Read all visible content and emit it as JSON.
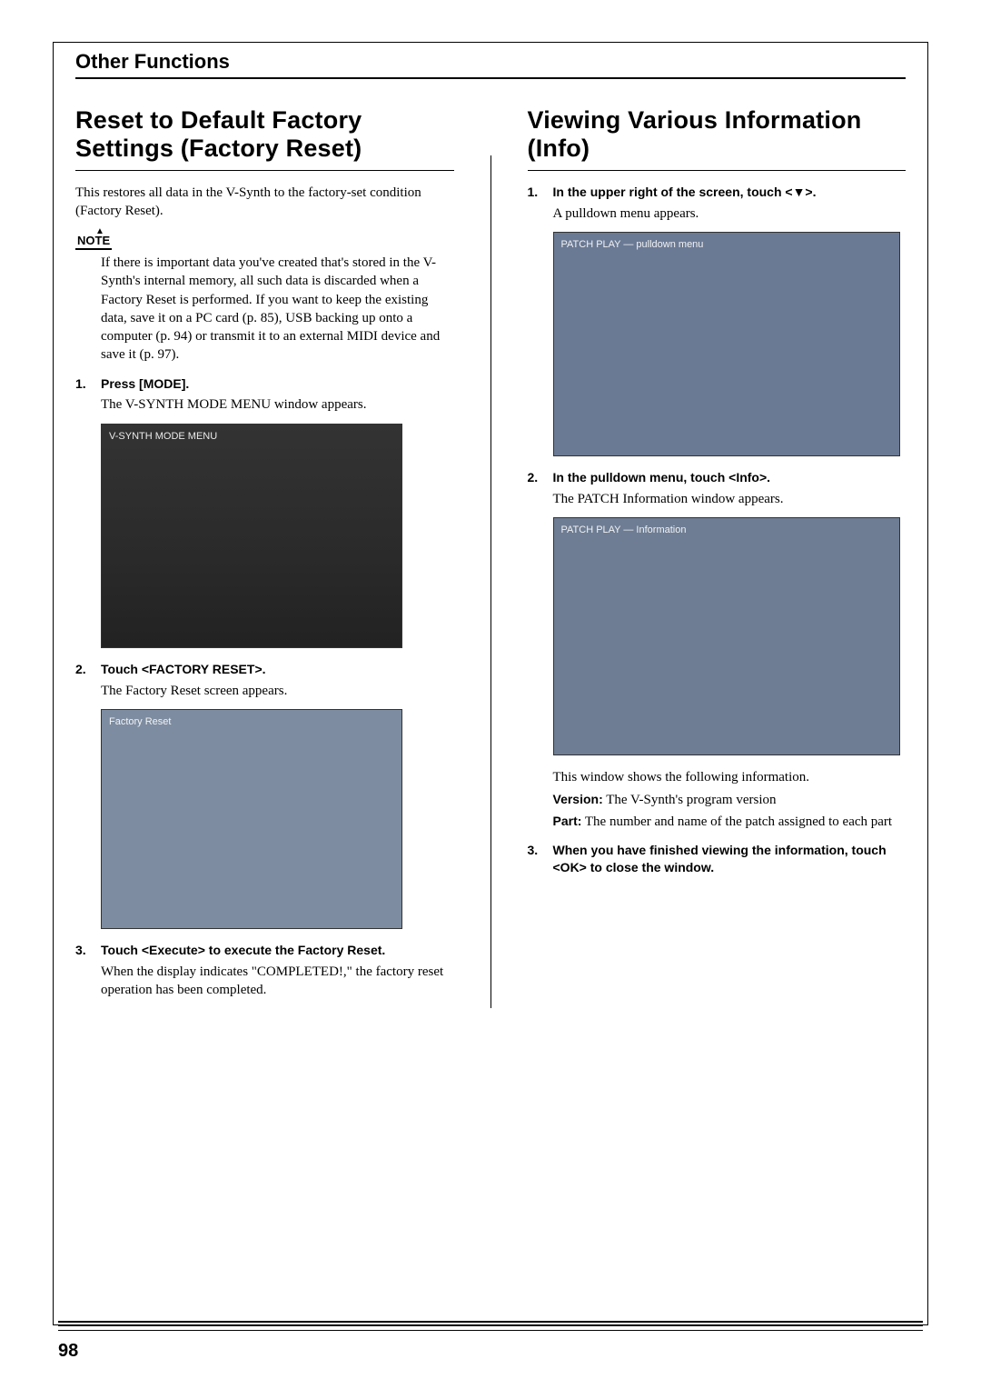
{
  "page": {
    "number": "98"
  },
  "header": {
    "section_title": "Other Functions"
  },
  "left": {
    "title_line1": "Reset to Default Factory",
    "title_line2": "Settings (Factory Reset)",
    "intro": "This restores all data in the V-Synth to the factory-set condition (Factory Reset).",
    "note_label": "NOTE",
    "note_body": "If there is important data you've created that's stored in the V-Synth's internal memory, all such data is discarded when a Factory Reset is performed. If you want to keep the existing data, save it on a PC card (p. 85), USB backing up onto a computer (p. 94) or transmit it to an external MIDI device and save it (p. 97).",
    "step1_num": "1.",
    "step1_head": "Press [MODE].",
    "step1_body": "The V-SYNTH MODE MENU window appears.",
    "img1": "V-SYNTH MODE MENU",
    "step2_num": "2.",
    "step2_head": "Touch <FACTORY RESET>.",
    "step2_body": "The Factory Reset screen appears.",
    "img2": "Factory Reset",
    "step3_num": "3.",
    "step3_head": "Touch <Execute> to execute the Factory Reset.",
    "step3_body": "When the display indicates \"COMPLETED!,\" the factory reset operation has been completed."
  },
  "right": {
    "title_line1": "Viewing Various Information",
    "title_line2": "(Info)",
    "step1_num": "1.",
    "step1_head": "In the upper right of the screen, touch <▼>.",
    "step1_body": "A pulldown menu appears.",
    "img1": "PATCH PLAY — pulldown menu",
    "step2_num": "2.",
    "step2_head": "In the pulldown menu, touch <Info>.",
    "step2_body": "The PATCH Information window appears.",
    "img2": "PATCH PLAY — Information",
    "after_para": "This window shows the following information.",
    "version_label": "Version:",
    "version_text": " The V-Synth's program version",
    "part_label": "Part:",
    "part_text": " The number and name of the patch assigned to each part",
    "step3_num": "3.",
    "step3_head": "When you have finished viewing the information, touch <OK> to close the window."
  }
}
